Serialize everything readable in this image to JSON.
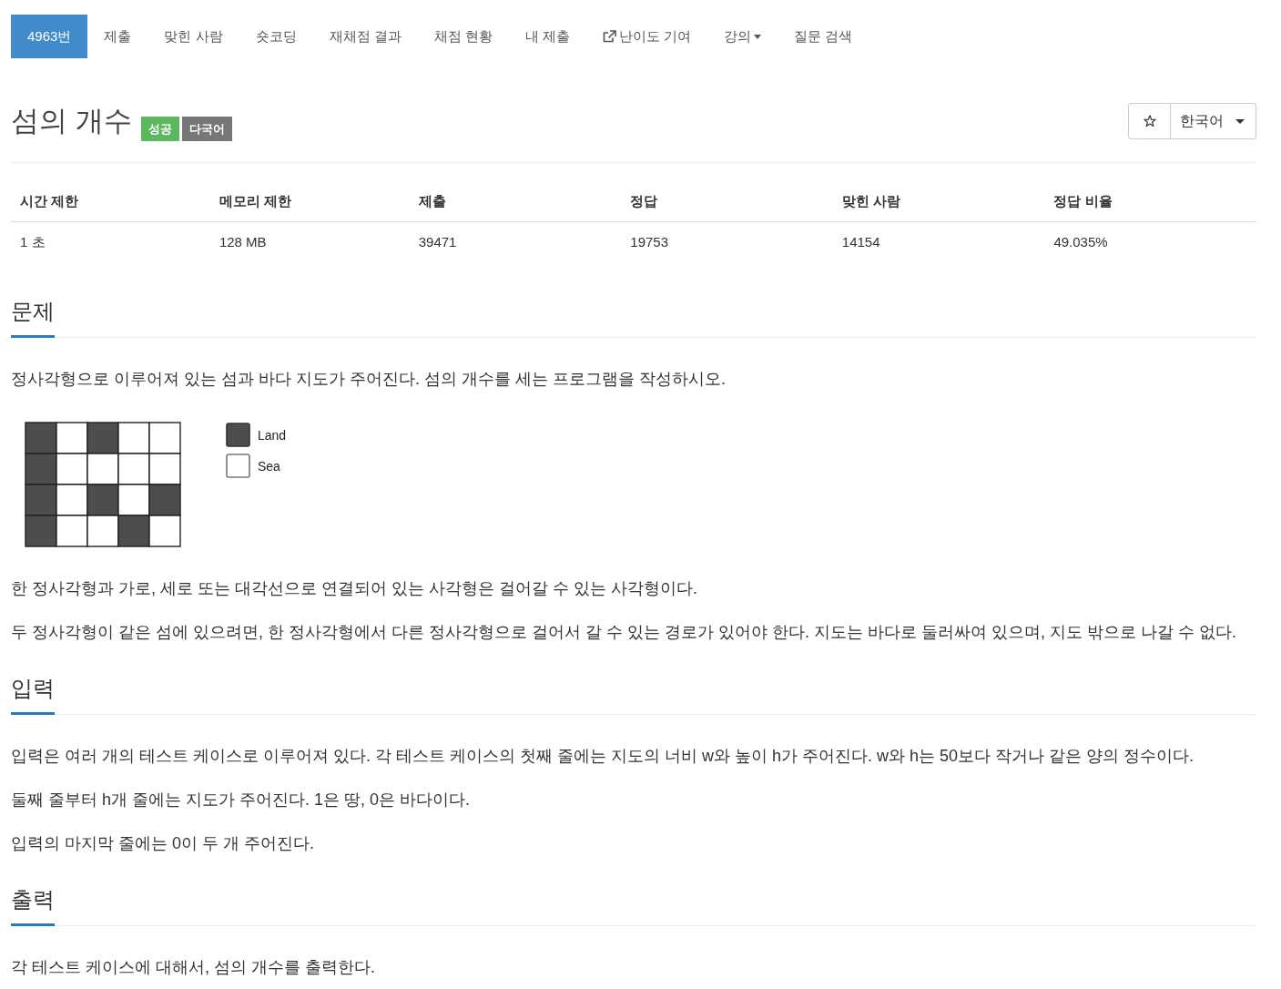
{
  "nav": [
    {
      "label": "4963번",
      "selected": true,
      "kind": "link"
    },
    {
      "label": "제출",
      "selected": false,
      "kind": "link"
    },
    {
      "label": "맞힌 사람",
      "selected": false,
      "kind": "link"
    },
    {
      "label": "숏코딩",
      "selected": false,
      "kind": "link"
    },
    {
      "label": "재채점 결과",
      "selected": false,
      "kind": "link"
    },
    {
      "label": "채점 현황",
      "selected": false,
      "kind": "link"
    },
    {
      "label": "내 제출",
      "selected": false,
      "kind": "link"
    },
    {
      "label": "난이도 기여",
      "selected": false,
      "kind": "external"
    },
    {
      "label": "강의",
      "selected": false,
      "kind": "dropdown"
    },
    {
      "label": "질문 검색",
      "selected": false,
      "kind": "link"
    }
  ],
  "problem": {
    "title": "섬의 개수",
    "labels": [
      {
        "text": "성공",
        "color": "#5cb85c"
      },
      {
        "text": "다국어",
        "color": "#777777"
      }
    ],
    "favorite": {
      "starred": false
    },
    "language": {
      "value": "한국어"
    }
  },
  "stats": {
    "columns": [
      "시간 제한",
      "메모리 제한",
      "제출",
      "정답",
      "맞힌 사람",
      "정답 비율"
    ],
    "rows": [
      [
        "1 초",
        "128 MB",
        "39471",
        "19753",
        "14154",
        "49.035%"
      ]
    ]
  },
  "sections": [
    {
      "title": "문제",
      "content": [
        {
          "kind": "text",
          "text": "정사각형으로 이루어져 있는 섬과 바다 지도가 주어진다. 섬의 개수를 세는 프로그램을 작성하시오."
        },
        {
          "kind": "figure",
          "rows": [
            [
              {
                "land": true
              },
              {
                "land": false
              },
              {
                "land": true
              },
              {
                "land": false
              },
              {
                "land": false
              }
            ],
            [
              {
                "land": true
              },
              {
                "land": false
              },
              {
                "land": false
              },
              {
                "land": false
              },
              {
                "land": false
              }
            ],
            [
              {
                "land": true
              },
              {
                "land": false
              },
              {
                "land": true
              },
              {
                "land": false
              },
              {
                "land": true
              }
            ],
            [
              {
                "land": true
              },
              {
                "land": false
              },
              {
                "land": false
              },
              {
                "land": true
              },
              {
                "land": false
              }
            ]
          ],
          "legend": [
            {
              "kind": "land",
              "label": "Land"
            },
            {
              "kind": "sea",
              "label": "Sea"
            }
          ]
        },
        {
          "kind": "text",
          "text": "한 정사각형과 가로, 세로 또는 대각선으로 연결되어 있는 사각형은 걸어갈 수 있는 사각형이다."
        },
        {
          "kind": "text",
          "text": "두 정사각형이 같은 섬에 있으려면, 한 정사각형에서 다른 정사각형으로 걸어서 갈 수 있는 경로가 있어야 한다. 지도는 바다로 둘러싸여 있으며, 지도 밖으로 나갈 수 없다."
        }
      ]
    },
    {
      "title": "입력",
      "content": [
        {
          "kind": "text",
          "text": "입력은 여러 개의 테스트 케이스로 이루어져 있다. 각 테스트 케이스의 첫째 줄에는 지도의 너비 w와 높이 h가 주어진다. w와 h는 50보다 작거나 같은 양의 정수이다."
        },
        {
          "kind": "text",
          "text": "둘째 줄부터 h개 줄에는 지도가 주어진다. 1은 땅, 0은 바다이다."
        },
        {
          "kind": "text",
          "text": "입력의 마지막 줄에는 0이 두 개 주어진다."
        }
      ]
    },
    {
      "title": "출력",
      "content": [
        {
          "kind": "text",
          "text": "각 테스트 케이스에 대해서, 섬의 개수를 출력한다."
        }
      ]
    }
  ]
}
